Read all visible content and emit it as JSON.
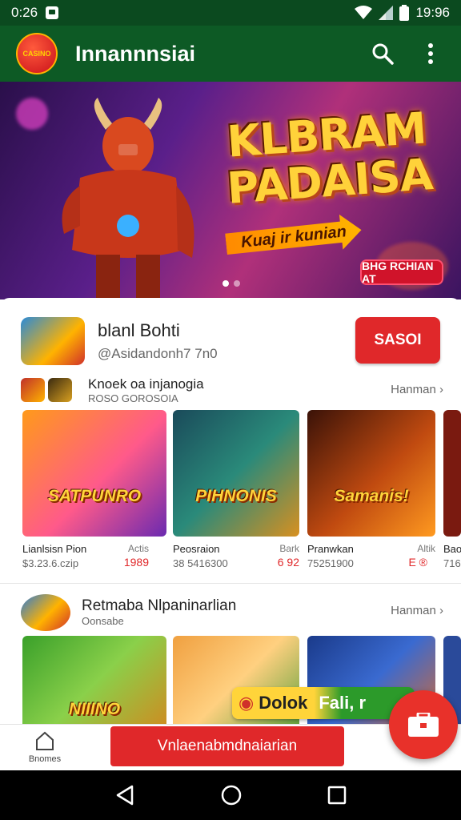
{
  "status_bar": {
    "time": "0:26",
    "clock": "19:96"
  },
  "app_bar": {
    "title": "Innannnsiai",
    "logo_text": "CASINO"
  },
  "hero": {
    "title_line1": "KLBRAM",
    "title_line2": "PADAISA",
    "arrow_text": "Kuaj ir kunian",
    "badge_text": "BHG RCHIAN AT",
    "active_slide": 0,
    "slide_count": 2
  },
  "app": {
    "name": "blanl Bohti",
    "developer": "@Asidandonh7 7n0",
    "install_label": "SASOI"
  },
  "section1": {
    "title": "Knoek oa injanogia",
    "subtitle": "ROSO GOROSOIA",
    "more_label": "Hanman",
    "cards": [
      {
        "art_title": "SATPUNRO",
        "name": "Lianlsisn Pion",
        "tag": "Actis",
        "meta": "$3.23.6.czip",
        "price": "1989"
      },
      {
        "art_title": "PIHNONIS",
        "name": "Peosraion",
        "tag": "Bark",
        "meta": "38 5416300",
        "price": "6 92"
      },
      {
        "art_title": "Samanis!",
        "name": "Pranwkan",
        "tag": "Altik",
        "meta": "75251900",
        "price": "E ®"
      },
      {
        "art_title": "",
        "name": "Bao",
        "tag": "",
        "meta": "716",
        "price": ""
      }
    ]
  },
  "section2": {
    "title": "Retmaba Nlpaninarlian",
    "subtitle": "Oonsabe",
    "more_label": "Hanman",
    "cards": [
      {
        "art_title": "NIIINO"
      },
      {
        "art_title": ""
      },
      {
        "art_title": ""
      },
      {
        "art_title": ""
      }
    ]
  },
  "promo": {
    "part1": "Dolok",
    "part2": "Fali, r"
  },
  "bottom_bar": {
    "home_label": "Bnomes",
    "cta_label": "Vnlaenabmdnaiarian"
  },
  "colors": {
    "status_bar": "#0b4a1f",
    "app_bar": "#0d5a25",
    "accent": "#e0282a"
  }
}
